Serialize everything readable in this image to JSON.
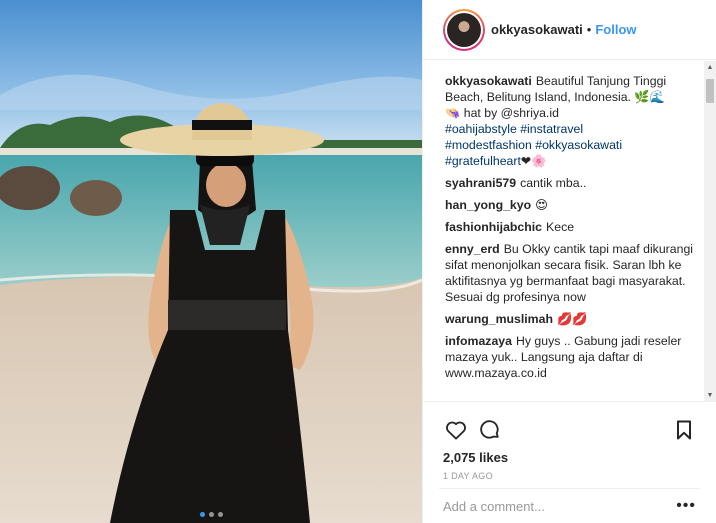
{
  "post": {
    "username": "okkyasokawati",
    "separator": "•",
    "follow_label": "Follow",
    "caption": {
      "text": "Beautiful Tanjung Tinggi Beach, Belitung Island, Indonesia. 🌿🌊",
      "hat_line": "👒 hat by @shriya.id",
      "hashtags": [
        "#oahijabstyle",
        "#instatravel",
        "#modestfashion",
        "#okkyasokawati",
        "#gratefulheart"
      ],
      "end_emoji": "❤🌸"
    },
    "comments": [
      {
        "user": "syahrani579",
        "text": "cantik mba.."
      },
      {
        "user": "han_yong_kyo",
        "text": "😍"
      },
      {
        "user": "fashionhijabchic",
        "text": "Kece"
      },
      {
        "user": "enny_erd",
        "text": "Bu Okky cantik tapi maaf dikurangi sifat menonjolkan secara fisik. Saran lbh ke aktifitasnya yg bermanfaat bagi masyarakat. Sesuai dg profesinya now"
      },
      {
        "user": "warung_muslimah",
        "text": "💋💋"
      },
      {
        "user": "infomazaya",
        "text": "Hy guys .. Gabung jadi reseler mazaya yuk.. Langsung aja daftar di www.mazaya.co.id"
      }
    ],
    "likes": "2,075 likes",
    "time": "1 DAY AGO",
    "add_comment_placeholder": "Add a comment...",
    "more_label": "•••",
    "carousel": {
      "count": 3,
      "active": 0
    }
  },
  "icons": {
    "like": "heart-icon",
    "comment": "comment-bubble-icon",
    "save": "bookmark-icon"
  },
  "colors": {
    "link": "#3897f0",
    "hashtag": "#003569",
    "text": "#262626",
    "muted": "#999999"
  }
}
